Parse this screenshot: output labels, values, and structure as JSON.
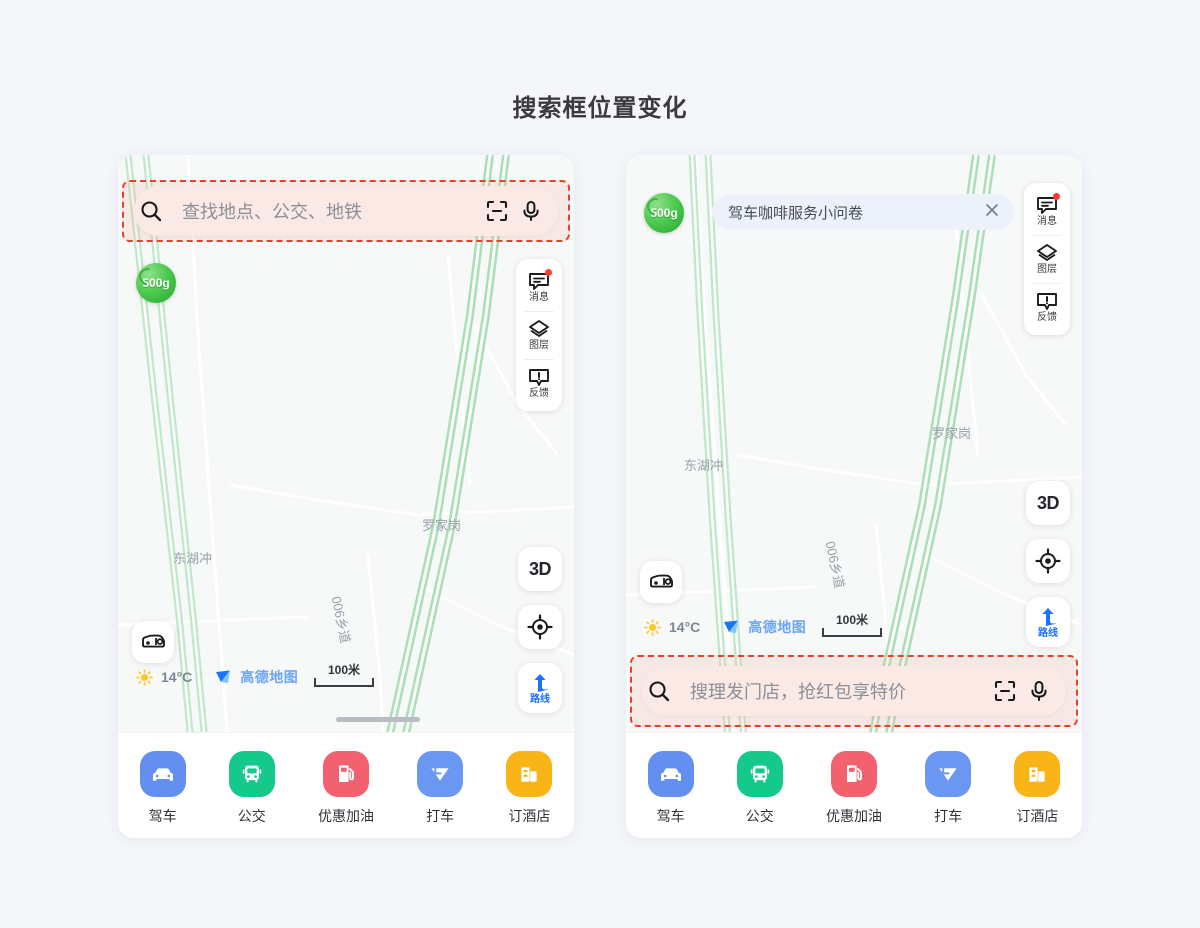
{
  "page": {
    "title": "搜索框位置变化",
    "background_color": "#f4f6fa",
    "highlight_color": "#e8412a",
    "search_fill_color": "#fbe9e5"
  },
  "map": {
    "labels": [
      {
        "text": "东湖冲"
      },
      {
        "text": "罗家岗"
      }
    ],
    "road_name": "006乡道",
    "eco_badge": "500g",
    "bg_color": "#f7f8f8",
    "road_color": "#8bd6a0"
  },
  "status": {
    "weather_icon": "sun-icon",
    "temperature": "14°C",
    "brand": "高德地图",
    "scale": "100米"
  },
  "controls": {
    "stack": [
      {
        "icon": "message-icon",
        "label": "消息",
        "badge": true
      },
      {
        "icon": "layers-icon",
        "label": "图层",
        "badge": false
      },
      {
        "icon": "feedback-icon",
        "label": "反馈",
        "badge": false
      }
    ],
    "three_d": "3D",
    "locate": "locate-icon",
    "route_label": "路线",
    "vehicle": "car-icon"
  },
  "left_phone": {
    "search": {
      "placeholder": "查找地点、公交、地铁",
      "search_icon": "search-icon",
      "scan_icon": "scan-icon",
      "mic_icon": "mic-icon"
    }
  },
  "right_phone": {
    "promo": {
      "text": "驾车咖啡服务小问卷",
      "close_icon": "close-icon"
    },
    "search": {
      "placeholder": "搜理发门店，抢红包享特价",
      "search_icon": "search-icon",
      "scan_icon": "scan-icon",
      "mic_icon": "mic-icon"
    }
  },
  "bottom_nav": [
    {
      "label": "驾车",
      "icon": "car-icon",
      "color": "#6390f0"
    },
    {
      "label": "公交",
      "icon": "bus-icon",
      "color": "#15c98a"
    },
    {
      "label": "优惠加油",
      "icon": "fuel-icon",
      "color": "#f4616e"
    },
    {
      "label": "打车",
      "icon": "taxi-icon",
      "color": "#6a97f2"
    },
    {
      "label": "订酒店",
      "icon": "hotel-icon",
      "color": "#f9b418"
    }
  ]
}
